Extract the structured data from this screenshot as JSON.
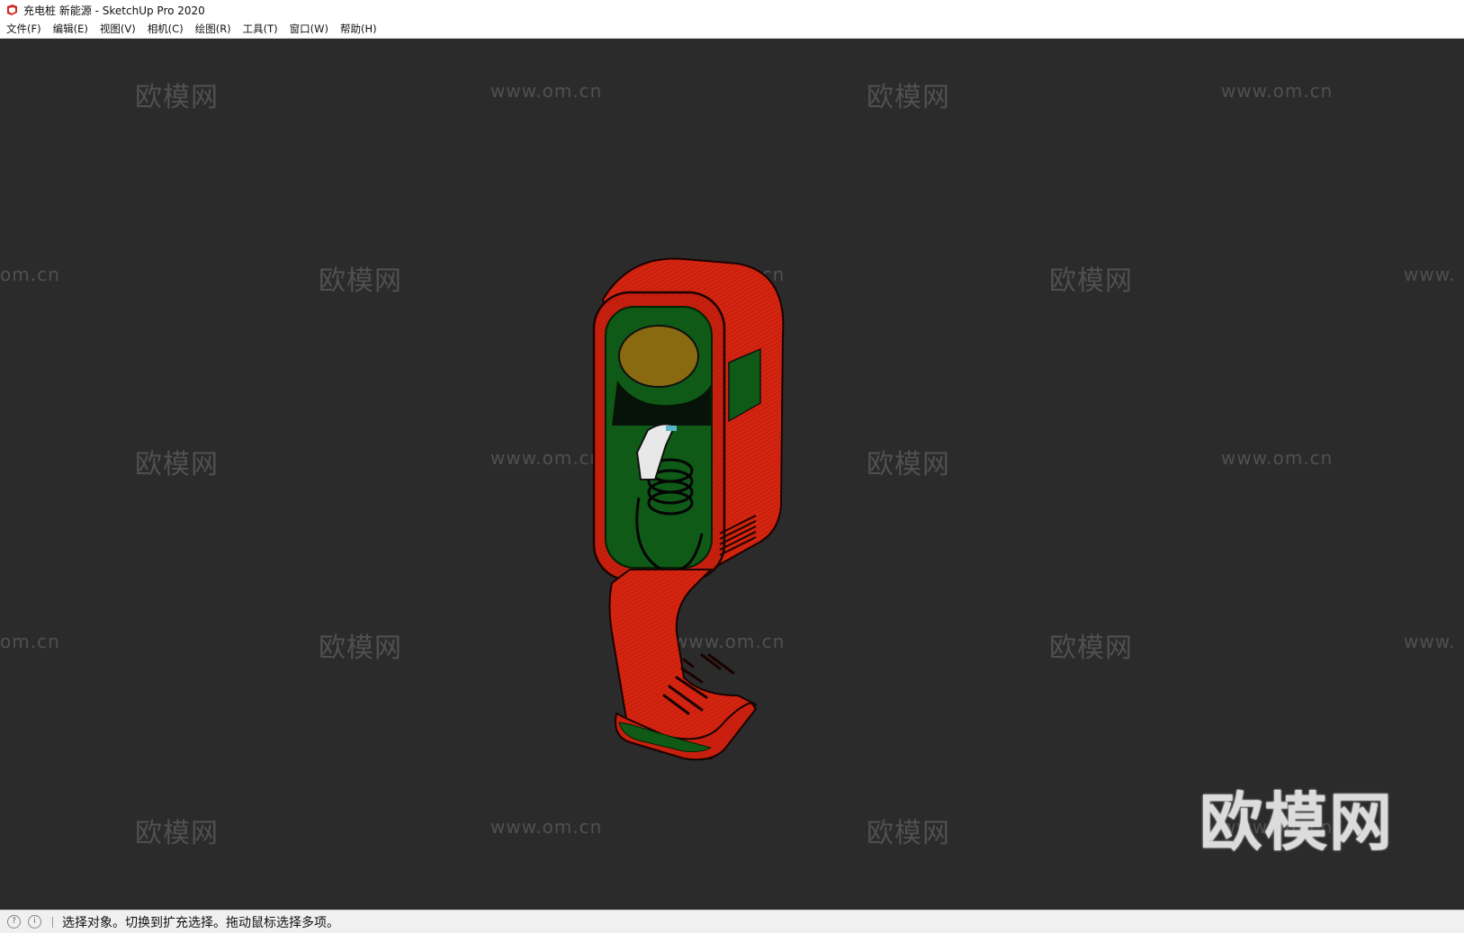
{
  "window": {
    "title": "充电桩 新能源 - SketchUp Pro 2020"
  },
  "menu": {
    "items": [
      "文件(F)",
      "编辑(E)",
      "视图(V)",
      "相机(C)",
      "绘图(R)",
      "工具(T)",
      "窗口(W)",
      "帮助(H)"
    ]
  },
  "viewport": {
    "background": "#2b2b2b",
    "watermark_cn": "欧模网",
    "watermark_url": "www.om.cn",
    "watermark_url_partial_left": "om.cn",
    "watermark_url_partial_right": "www.",
    "watermark_big": "欧模网",
    "model_colors": {
      "body": "#d62410",
      "panel": "#0f5a16",
      "screen": "#8a6a10"
    }
  },
  "status": {
    "text": "选择对象。切换到扩充选择。拖动鼠标选择多项。"
  }
}
